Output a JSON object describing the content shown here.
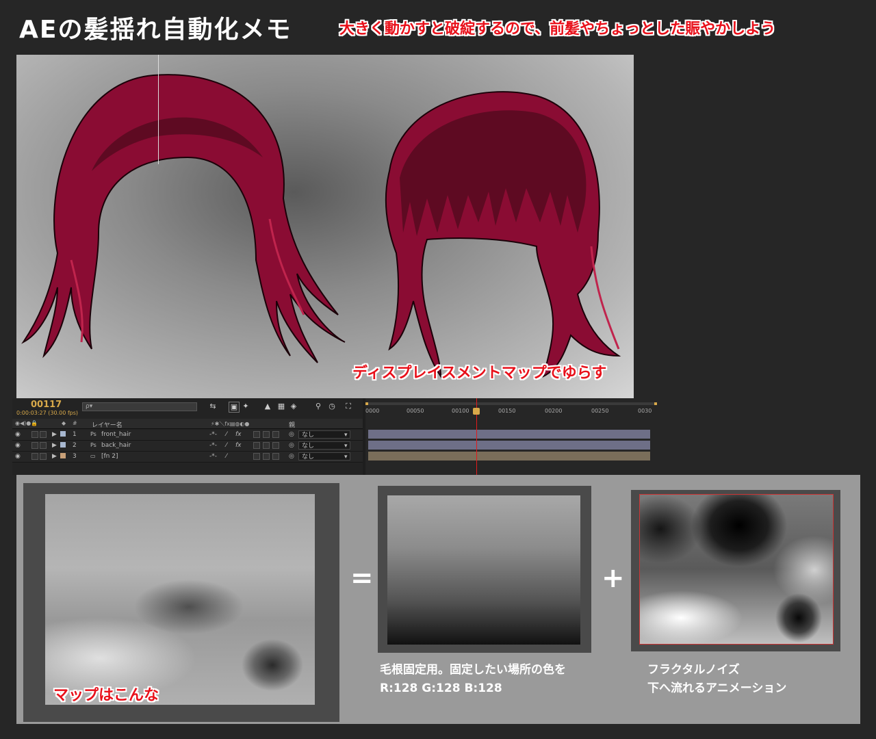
{
  "header": {
    "title": "AEの髪揺れ自動化メモ",
    "subtitle": "大きく動かすと破綻するので、前髪やちょっとした賑やかしよう"
  },
  "viewer": {
    "caption": "ディスプレイスメントマップでゆらす",
    "hair_color": "#8a0c33"
  },
  "timeline": {
    "frame_number": "00117",
    "timecode": "0:00:03:27 (30.00 fps)",
    "search_placeholder": "ρ▾",
    "columns": {
      "layer_name": "レイヤー名",
      "number": "#",
      "parent": "親"
    },
    "layers": [
      {
        "index": "1",
        "name": "front_hair",
        "parent": "なし",
        "label_color": "#a8b8d0",
        "track_color": "#6e6f87"
      },
      {
        "index": "2",
        "name": "back_hair",
        "parent": "なし",
        "label_color": "#a8b8d0",
        "track_color": "#6e6f87"
      },
      {
        "index": "3",
        "name": "[fn 2]",
        "parent": "なし",
        "label_color": "#c8a078",
        "track_color": "#7a6e5a"
      }
    ],
    "ruler_ticks": [
      "0000",
      "00050",
      "00100",
      "00150",
      "00200",
      "00250",
      "0030"
    ],
    "playhead_color": "#e21b1b"
  },
  "bottom": {
    "map_caption": "マップはこんな",
    "equals": "=",
    "plus": "+",
    "gradient_desc_line1": "毛根固定用。固定したい場所の色を",
    "gradient_desc_line2": "R:128 G:128 B:128",
    "noise_desc_line1": "フラクタルノイズ",
    "noise_desc_line2": "下へ流れるアニメーション"
  }
}
